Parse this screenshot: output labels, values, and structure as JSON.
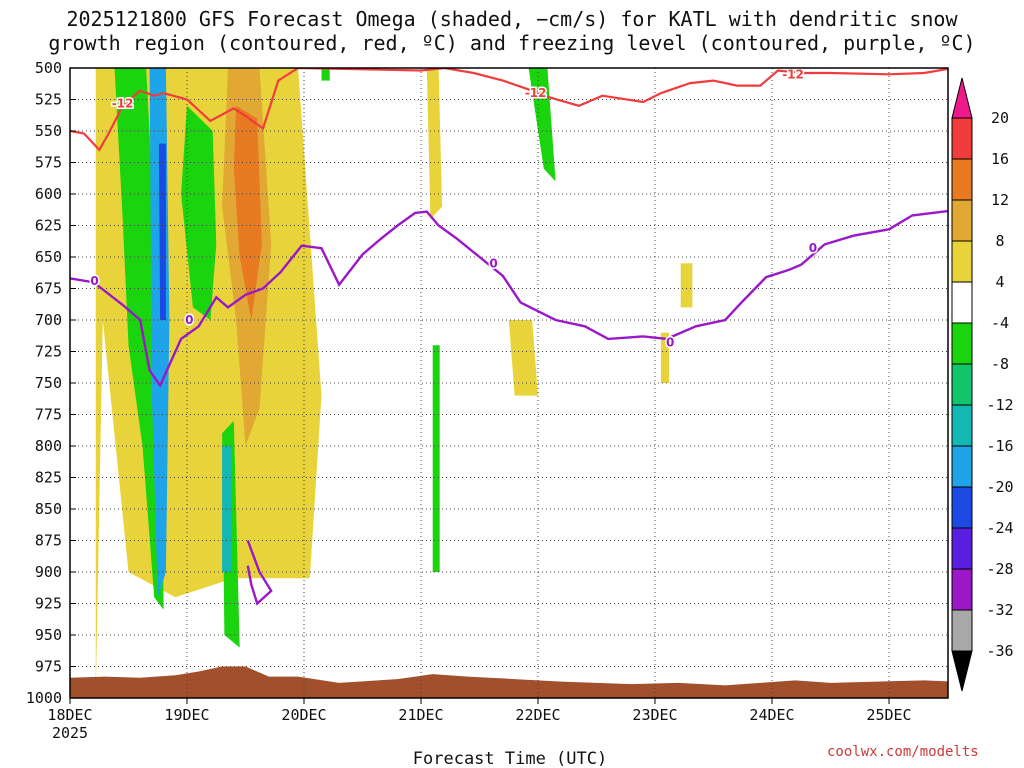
{
  "title_line1": "2025121800 GFS Forecast Omega (shaded, −cm/s) for KATL with dendritic snow",
  "title_line2": "growth region (contoured, red, ºC) and freezing level (contoured, purple, ºC)",
  "credit": "coolwx.com/modelts",
  "chart_data": {
    "type": "heatmap",
    "xlabel": "Forecast Time (UTC)",
    "x_ticks": [
      "18DEC",
      "19DEC",
      "20DEC",
      "21DEC",
      "22DEC",
      "23DEC",
      "24DEC",
      "25DEC"
    ],
    "x_tick_sublabel": "2025",
    "x_range_days": [
      0,
      7.55
    ],
    "y_axis": {
      "reversed": true,
      "range": [
        500,
        1000
      ],
      "ticks": [
        500,
        525,
        550,
        575,
        600,
        625,
        650,
        675,
        700,
        725,
        750,
        775,
        800,
        825,
        850,
        875,
        900,
        925,
        950,
        975,
        1000
      ]
    },
    "grid": true,
    "colorbar": {
      "labels": [
        "20",
        "16",
        "12",
        "8",
        "4",
        "-4",
        "-8",
        "-12",
        "-16",
        "-20",
        "-24",
        "-28",
        "-32",
        "-36"
      ],
      "colors": [
        "#f03c3c",
        "#e87a22",
        "#e2a834",
        "#e8d43a",
        "#ffffff",
        "#1ad40e",
        "#12c46a",
        "#14b8b2",
        "#1ea4e8",
        "#1a4ae2",
        "#5a1ee0",
        "#9a18c8",
        "#a8a8a8"
      ],
      "top_triangle_color": "#ee1a8a",
      "bottom_triangle_color": "#000000"
    },
    "omega_regions": [
      {
        "color": "#e8d43a",
        "points": [
          [
            0.22,
            1000
          ],
          [
            0.22,
            500
          ],
          [
            1.95,
            500
          ],
          [
            2.15,
            760
          ],
          [
            2.05,
            905
          ],
          [
            1.4,
            905
          ],
          [
            0.9,
            920
          ],
          [
            0.5,
            900
          ],
          [
            0.28,
            700
          ]
        ]
      },
      {
        "color": "#e2a834",
        "points": [
          [
            1.35,
            500
          ],
          [
            1.62,
            500
          ],
          [
            1.72,
            640
          ],
          [
            1.62,
            770
          ],
          [
            1.5,
            800
          ],
          [
            1.42,
            700
          ],
          [
            1.3,
            610
          ]
        ]
      },
      {
        "color": "#e87a22",
        "points": [
          [
            1.42,
            530
          ],
          [
            1.6,
            540
          ],
          [
            1.64,
            640
          ],
          [
            1.55,
            700
          ],
          [
            1.45,
            650
          ],
          [
            1.4,
            580
          ]
        ]
      },
      {
        "color": "#1ad40e",
        "points": [
          [
            0.38,
            500
          ],
          [
            0.65,
            500
          ],
          [
            0.72,
            620
          ],
          [
            0.78,
            760
          ],
          [
            0.8,
            930
          ],
          [
            0.72,
            920
          ],
          [
            0.62,
            800
          ],
          [
            0.5,
            720
          ],
          [
            0.45,
            620
          ]
        ]
      },
      {
        "color": "#1ad40e",
        "points": [
          [
            1.0,
            530
          ],
          [
            1.22,
            550
          ],
          [
            1.25,
            640
          ],
          [
            1.2,
            700
          ],
          [
            1.05,
            690
          ],
          [
            0.95,
            600
          ]
        ]
      },
      {
        "color": "#1ad40e",
        "points": [
          [
            1.3,
            790
          ],
          [
            1.4,
            780
          ],
          [
            1.45,
            960
          ],
          [
            1.32,
            950
          ]
        ]
      },
      {
        "color": "#1ad40e",
        "points": [
          [
            3.1,
            720
          ],
          [
            3.16,
            720
          ],
          [
            3.16,
            900
          ],
          [
            3.1,
            900
          ]
        ]
      },
      {
        "color": "#1ad40e",
        "points": [
          [
            3.92,
            500
          ],
          [
            4.08,
            500
          ],
          [
            4.15,
            590
          ],
          [
            4.05,
            580
          ]
        ]
      },
      {
        "color": "#1ad40e",
        "points": [
          [
            2.15,
            500
          ],
          [
            2.22,
            500
          ],
          [
            2.22,
            510
          ],
          [
            2.15,
            510
          ]
        ]
      },
      {
        "color": "#1ea4e8",
        "points": [
          [
            0.68,
            500
          ],
          [
            0.82,
            500
          ],
          [
            0.85,
            700
          ],
          [
            0.82,
            900
          ],
          [
            0.75,
            920
          ],
          [
            0.7,
            760
          ]
        ]
      },
      {
        "color": "#1a4ae2",
        "points": [
          [
            0.76,
            560
          ],
          [
            0.82,
            560
          ],
          [
            0.82,
            700
          ],
          [
            0.77,
            700
          ]
        ]
      },
      {
        "color": "#14b8b2",
        "points": [
          [
            1.3,
            800
          ],
          [
            1.38,
            800
          ],
          [
            1.38,
            900
          ],
          [
            1.3,
            900
          ]
        ]
      },
      {
        "color": "#e8d43a",
        "points": [
          [
            3.05,
            500
          ],
          [
            3.15,
            500
          ],
          [
            3.18,
            610
          ],
          [
            3.08,
            620
          ]
        ]
      },
      {
        "color": "#e8d43a",
        "points": [
          [
            3.75,
            700
          ],
          [
            3.95,
            700
          ],
          [
            4.0,
            760
          ],
          [
            3.8,
            760
          ]
        ]
      },
      {
        "color": "#e8d43a",
        "points": [
          [
            5.22,
            655
          ],
          [
            5.32,
            655
          ],
          [
            5.32,
            690
          ],
          [
            5.22,
            690
          ]
        ]
      },
      {
        "color": "#e8d43a",
        "points": [
          [
            5.05,
            710
          ],
          [
            5.12,
            710
          ],
          [
            5.12,
            750
          ],
          [
            5.05,
            750
          ]
        ]
      }
    ],
    "dgz_contour": {
      "label": "-12",
      "color": "#f03c3c",
      "points": [
        [
          0,
          550
        ],
        [
          0.12,
          552
        ],
        [
          0.25,
          565
        ],
        [
          0.33,
          552
        ],
        [
          0.45,
          530
        ],
        [
          0.6,
          518
        ],
        [
          0.72,
          522
        ],
        [
          0.8,
          520
        ],
        [
          1.0,
          525
        ],
        [
          1.2,
          542
        ],
        [
          1.4,
          532
        ],
        [
          1.5,
          538
        ],
        [
          1.65,
          548
        ],
        [
          1.78,
          510
        ],
        [
          1.95,
          500
        ],
        [
          3.0,
          502
        ],
        [
          3.2,
          500
        ],
        [
          3.45,
          504
        ],
        [
          3.7,
          510
        ],
        [
          3.95,
          518
        ],
        [
          4.05,
          522
        ],
        [
          4.35,
          530
        ],
        [
          4.55,
          522
        ],
        [
          4.9,
          527
        ],
        [
          5.05,
          520
        ],
        [
          5.3,
          512
        ],
        [
          5.5,
          510
        ],
        [
          5.7,
          514
        ],
        [
          5.9,
          514
        ],
        [
          6.05,
          502
        ],
        [
          6.25,
          504
        ],
        [
          6.5,
          504
        ],
        [
          7.0,
          505
        ],
        [
          7.3,
          504
        ],
        [
          7.55,
          500
        ]
      ],
      "labels_at": [
        [
          0.45,
          528
        ],
        [
          3.98,
          520
        ],
        [
          6.18,
          505
        ]
      ]
    },
    "freezing_contour": {
      "label": "0",
      "color": "#9a18c8",
      "points": [
        [
          0,
          667
        ],
        [
          0.2,
          670
        ],
        [
          0.45,
          688
        ],
        [
          0.6,
          700
        ],
        [
          0.68,
          740
        ],
        [
          0.77,
          752
        ],
        [
          0.95,
          715
        ],
        [
          1.1,
          705
        ],
        [
          1.25,
          682
        ],
        [
          1.35,
          690
        ],
        [
          1.5,
          680
        ],
        [
          1.65,
          675
        ],
        [
          1.8,
          662
        ],
        [
          1.98,
          641
        ],
        [
          2.15,
          643
        ],
        [
          2.3,
          672
        ],
        [
          2.5,
          648
        ],
        [
          2.65,
          636
        ],
        [
          2.8,
          625
        ],
        [
          2.95,
          615
        ],
        [
          3.05,
          614
        ],
        [
          3.15,
          625
        ],
        [
          3.3,
          635
        ],
        [
          3.5,
          650
        ],
        [
          3.7,
          665
        ],
        [
          3.85,
          686
        ],
        [
          4.0,
          693
        ],
        [
          4.15,
          700
        ],
        [
          4.4,
          705
        ],
        [
          4.6,
          715
        ],
        [
          4.9,
          713
        ],
        [
          5.1,
          715
        ],
        [
          5.35,
          705
        ],
        [
          5.6,
          700
        ],
        [
          5.75,
          685
        ],
        [
          5.95,
          666
        ],
        [
          6.15,
          660
        ],
        [
          6.25,
          656
        ],
        [
          6.45,
          640
        ],
        [
          6.7,
          633
        ],
        [
          7.0,
          628
        ],
        [
          7.2,
          617
        ],
        [
          7.55,
          613
        ]
      ],
      "labels_at": [
        [
          0.21,
          669
        ],
        [
          1.02,
          700
        ],
        [
          3.62,
          655
        ],
        [
          5.13,
          718
        ],
        [
          6.35,
          643
        ]
      ],
      "isolated": [
        [
          1.52,
          875
        ],
        [
          1.62,
          900
        ],
        [
          1.72,
          915
        ],
        [
          1.6,
          925
        ],
        [
          1.55,
          910
        ],
        [
          1.52,
          895
        ]
      ]
    },
    "terrain_color": "#a24f2b",
    "terrain_top": [
      [
        0,
        984
      ],
      [
        0.3,
        983
      ],
      [
        0.6,
        984
      ],
      [
        0.9,
        982
      ],
      [
        1.1,
        979
      ],
      [
        1.3,
        975
      ],
      [
        1.5,
        975
      ],
      [
        1.7,
        983
      ],
      [
        1.95,
        983
      ],
      [
        2.3,
        988
      ],
      [
        2.8,
        985
      ],
      [
        3.1,
        981
      ],
      [
        3.4,
        983
      ],
      [
        3.8,
        985
      ],
      [
        4.0,
        986
      ],
      [
        4.2,
        987
      ],
      [
        4.5,
        988
      ],
      [
        4.8,
        989
      ],
      [
        5.2,
        988
      ],
      [
        5.6,
        990
      ],
      [
        5.9,
        988
      ],
      [
        6.2,
        986
      ],
      [
        6.5,
        988
      ],
      [
        6.9,
        987
      ],
      [
        7.3,
        986
      ],
      [
        7.55,
        987
      ]
    ]
  }
}
